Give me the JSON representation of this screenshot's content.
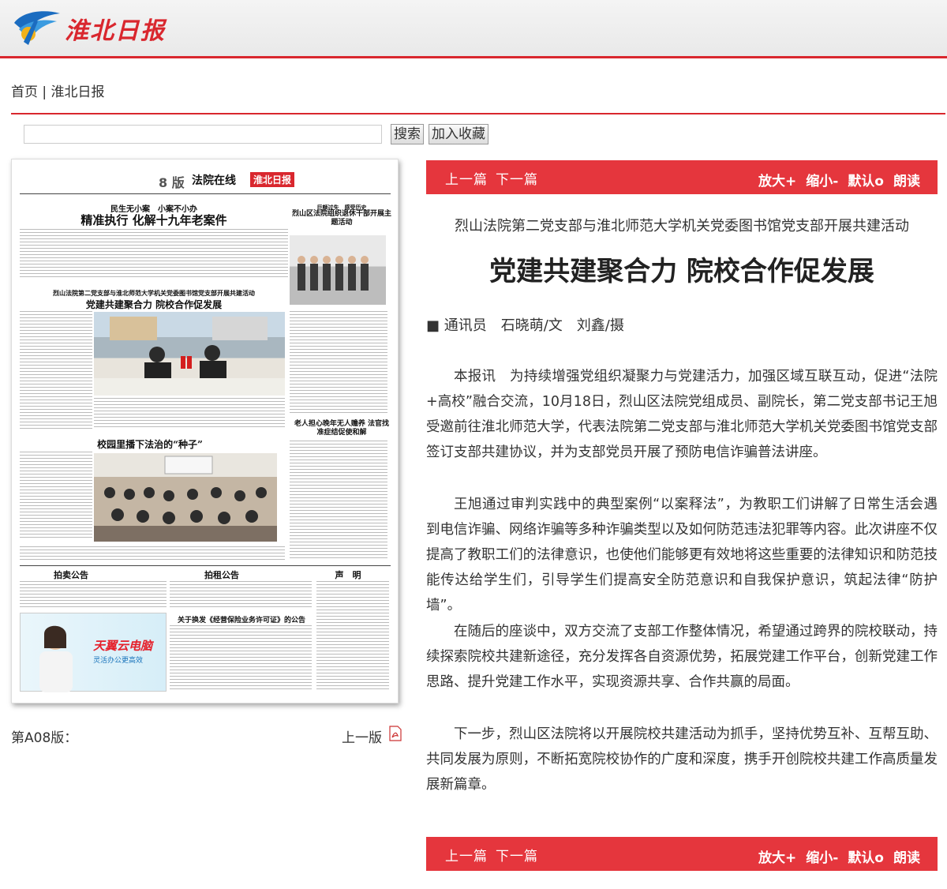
{
  "site": {
    "logo_text": "淮北日报"
  },
  "breadcrumb": {
    "home": "首页",
    "separator": " | ",
    "current": "淮北日报"
  },
  "search": {
    "placeholder": "",
    "value": "",
    "search_label": "搜索",
    "favorite_label": "加入收藏"
  },
  "paper_thumb": {
    "page_num": "8 版",
    "section": "法院在线",
    "logo": "淮北日报",
    "headline_1_kicker": "民生无小案　小案不小办",
    "headline_1": "精准执行 化解十九年老案件",
    "headline_2_kicker": "烈山法院第二党支部与淮北师范大学机关党委图书馆党支部开展共建活动",
    "headline_2": "党建共建聚合力 院校合作促发展",
    "headline_3": "校园里播下法治的“种子”",
    "headline_4_kicker": "巨额过失　感受历史",
    "headline_4": "烈山区法院组织退休干部开展主题活动",
    "headline_5": "老人担心晚年无人赡养 法官找准症结促使和解",
    "notice_1": "拍卖公告",
    "notice_2": "拍租公告",
    "notice_3": "声　明",
    "notice_4": "关于换发《经营保险业务许可证》的公告",
    "ad_title": "天翼云电脑",
    "ad_sub": "灵活办公更高效"
  },
  "page_nav": {
    "page_label": "第A08版：",
    "prev_page": "上一版"
  },
  "article_toolbar": {
    "prev": "上一篇",
    "next": "下一篇",
    "zoom_in": "放大+",
    "zoom_out": "缩小-",
    "default": "默认o",
    "read": "朗读"
  },
  "article": {
    "subtitle": "烈山法院第二党支部与淮北师范大学机关党委图书馆党支部开展共建活动",
    "title": "党建共建聚合力 院校合作促发展",
    "byline": "■ 通讯员　石晓萌/文　刘鑫/摄",
    "paragraphs": [
      "本报讯　为持续增强党组织凝聚力与党建活力，加强区域互联互动，促进“法院+高校”融合交流，10月18日，烈山区法院党组成员、副院长，第二党支部书记王旭受邀前往淮北师范大学，代表法院第二党支部与淮北师范大学机关党委图书馆党支部签订支部共建协议，并为支部党员开展了预防电信诈骗普法讲座。",
      "王旭通过审判实践中的典型案例“以案释法”，为教职工们讲解了日常生活会遇到电信诈骗、网络诈骗等多种诈骗类型以及如何防范违法犯罪等内容。此次讲座不仅提高了教职工们的法律意识，也使他们能够更有效地将这些重要的法律知识和防范技能传达给学生们，引导学生们提高安全防范意识和自我保护意识，筑起法律“防护墙”。",
      "在随后的座谈中，双方交流了支部工作整体情况，希望通过跨界的院校联动，持续探索院校共建新途径，充分发挥各自资源优势，拓展党建工作平台，创新党建工作思路、提升党建工作水平，实现资源共享、合作共赢的局面。",
      "下一步，烈山区法院将以开展院校共建活动为抓手，坚持优势互补、互帮互助、共同发展为原则，不断拓宽院校协作的广度和深度，携手开创院校共建工作高质量发展新篇章。"
    ]
  },
  "colors": {
    "accent": "#d9272e",
    "toolbar": "#e5363d"
  }
}
